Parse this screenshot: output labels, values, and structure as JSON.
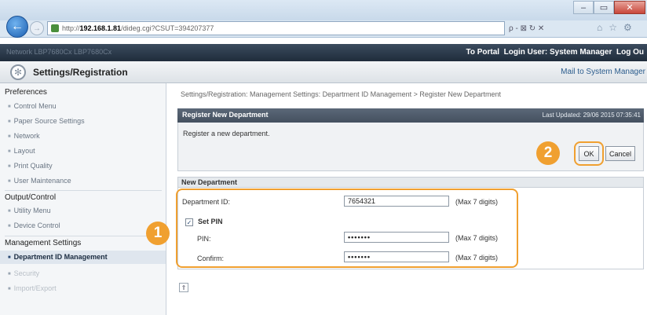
{
  "browser": {
    "url_prefix": "http://",
    "url_host": "192.168.1.81",
    "url_path": "/dideg.cgi?CSUT=394207377",
    "addr_tools": "ρ - ⊠ ↻ ✕"
  },
  "app_header": {
    "left_text": "Network  LBP7680Cx  LBP7680Cx",
    "portal": "To Portal",
    "login_user": "Login User: System Manager",
    "logout": "Log Ou"
  },
  "settings_bar": {
    "title": "Settings/Registration",
    "mail": "Mail to System Manager"
  },
  "sidebar": {
    "preferences": "Preferences",
    "control_menu": "Control Menu",
    "paper_source": "Paper Source Settings",
    "network": "Network",
    "layout": "Layout",
    "print_quality": "Print Quality",
    "user_maintenance": "User Maintenance",
    "output_control": "Output/Control",
    "utility_menu": "Utility Menu",
    "device_control": "Device Control",
    "management_settings": "Management Settings",
    "dept_id_mgmt": "Department ID Management",
    "security": "Security",
    "import_export": "Import/Export"
  },
  "breadcrumb": "Settings/Registration: Management Settings: Department ID Management > Register New Department",
  "register_panel": {
    "title": "Register New Department",
    "last_updated": "Last Updated: 29/06 2015 07:35:41",
    "message": "Register a new department.",
    "ok": "OK",
    "cancel": "Cancel"
  },
  "new_dept": {
    "title": "New Department",
    "dept_id_label": "Department ID:",
    "dept_id_value": "7654321",
    "dept_id_hint": "(Max 7 digits)",
    "set_pin_label": "Set PIN",
    "pin_label": "PIN:",
    "pin_value": "•••••••",
    "pin_hint": "(Max 7 digits)",
    "confirm_label": "Confirm:",
    "confirm_value": "•••••••",
    "confirm_hint": "(Max 7 digits)"
  },
  "callouts": {
    "one": "1",
    "two": "2"
  },
  "colors": {
    "accent": "#f0a030",
    "header_dark": "#44505f",
    "link": "#2a5b8c"
  }
}
